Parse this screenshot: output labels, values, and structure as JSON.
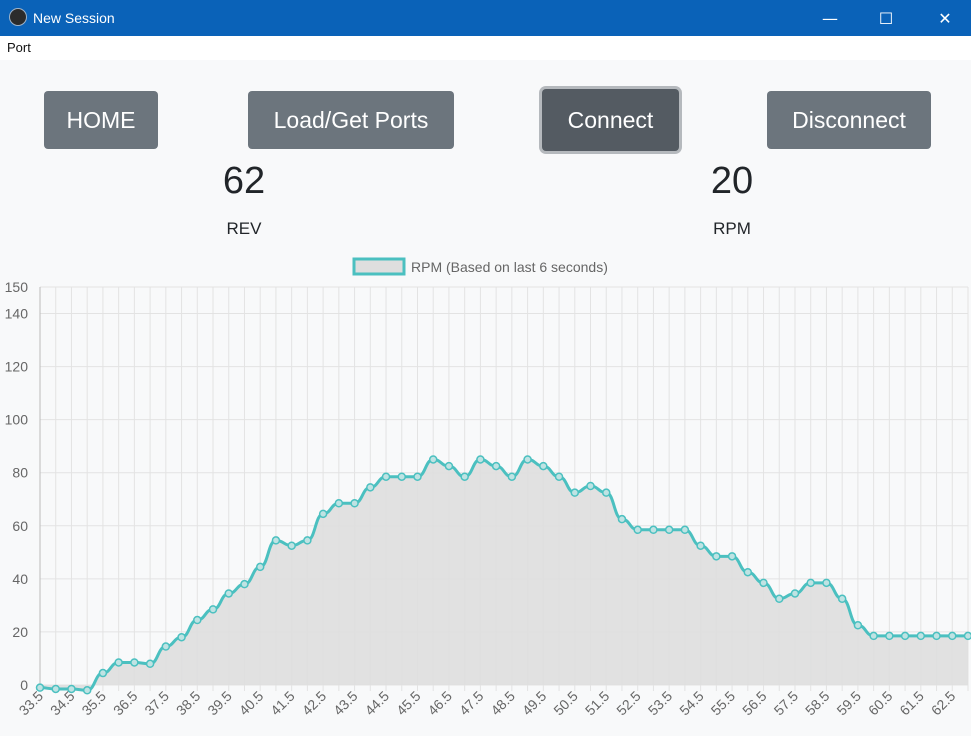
{
  "window": {
    "title": "New Session",
    "controls": {
      "minimize": "—",
      "maximize": "☐",
      "close": "✕"
    }
  },
  "menubar": {
    "items": [
      "Port"
    ]
  },
  "toolbar": {
    "home_label": "HOME",
    "load_ports_label": "Load/Get Ports",
    "connect_label": "Connect",
    "disconnect_label": "Disconnect"
  },
  "stats": {
    "rev": {
      "value": "62",
      "label": "REV"
    },
    "rpm": {
      "value": "20",
      "label": "RPM"
    }
  },
  "colors": {
    "titlebar": "#0a62b8",
    "button": "#6c757d",
    "button_active": "#545b62",
    "line": "#4bc0c0",
    "fill": "#dedede"
  },
  "chart_data": {
    "type": "line",
    "legend": "RPM (Based on last 6 seconds)",
    "legend_position": "top",
    "grid": true,
    "xlabel": "",
    "ylabel": "",
    "ylim": [
      0,
      150
    ],
    "yticks": [
      0,
      20,
      40,
      60,
      80,
      100,
      120,
      140,
      150
    ],
    "x": [
      33.5,
      34,
      34.5,
      35,
      35.5,
      36,
      36.5,
      37,
      37.5,
      38,
      38.5,
      39,
      39.5,
      40,
      40.5,
      41,
      41.5,
      42,
      42.5,
      43,
      43.5,
      44,
      44.5,
      45,
      45.5,
      46,
      46.5,
      47,
      47.5,
      48,
      48.5,
      49,
      49.5,
      50,
      50.5,
      51,
      51.5,
      52,
      52.5,
      53,
      53.5,
      54,
      54.5,
      55,
      55.5,
      56,
      56.5,
      57,
      57.5,
      58,
      58.5,
      59,
      59.5,
      60,
      60.5,
      61,
      61.5,
      62,
      62.5,
      63
    ],
    "x_tick_labels": [
      "33.5",
      "34.5",
      "35.5",
      "36.5",
      "37.5",
      "38.5",
      "39.5",
      "40.5",
      "41.5",
      "42.5",
      "43.5",
      "44.5",
      "45.5",
      "46.5",
      "47.5",
      "48.5",
      "49.5",
      "50.5",
      "51.5",
      "52.5",
      "53.5",
      "54.5",
      "55.5",
      "56.5",
      "57.5",
      "58.5",
      "59.5",
      "60.5",
      "61.5",
      "62.5"
    ],
    "series": [
      {
        "name": "RPM (Based on last 6 seconds)",
        "values": [
          -1,
          -1.5,
          -1.5,
          -2,
          4.5,
          8.5,
          8.5,
          8,
          14.5,
          18,
          24.5,
          28.5,
          34.5,
          38,
          44.5,
          54.5,
          52.5,
          54.5,
          64.5,
          68.5,
          68.5,
          74.5,
          78.5,
          78.5,
          78.5,
          85,
          82.5,
          78.5,
          85,
          82.5,
          78.5,
          85,
          82.5,
          78.5,
          72.5,
          75,
          72.5,
          62.5,
          58.5,
          58.5,
          58.5,
          58.5,
          52.5,
          48.5,
          48.5,
          42.5,
          38.5,
          32.5,
          34.5,
          38.5,
          38.5,
          32.5,
          22.5,
          18.5,
          18.5,
          18.5,
          18.5,
          18.5,
          18.5,
          18.5
        ]
      }
    ]
  }
}
